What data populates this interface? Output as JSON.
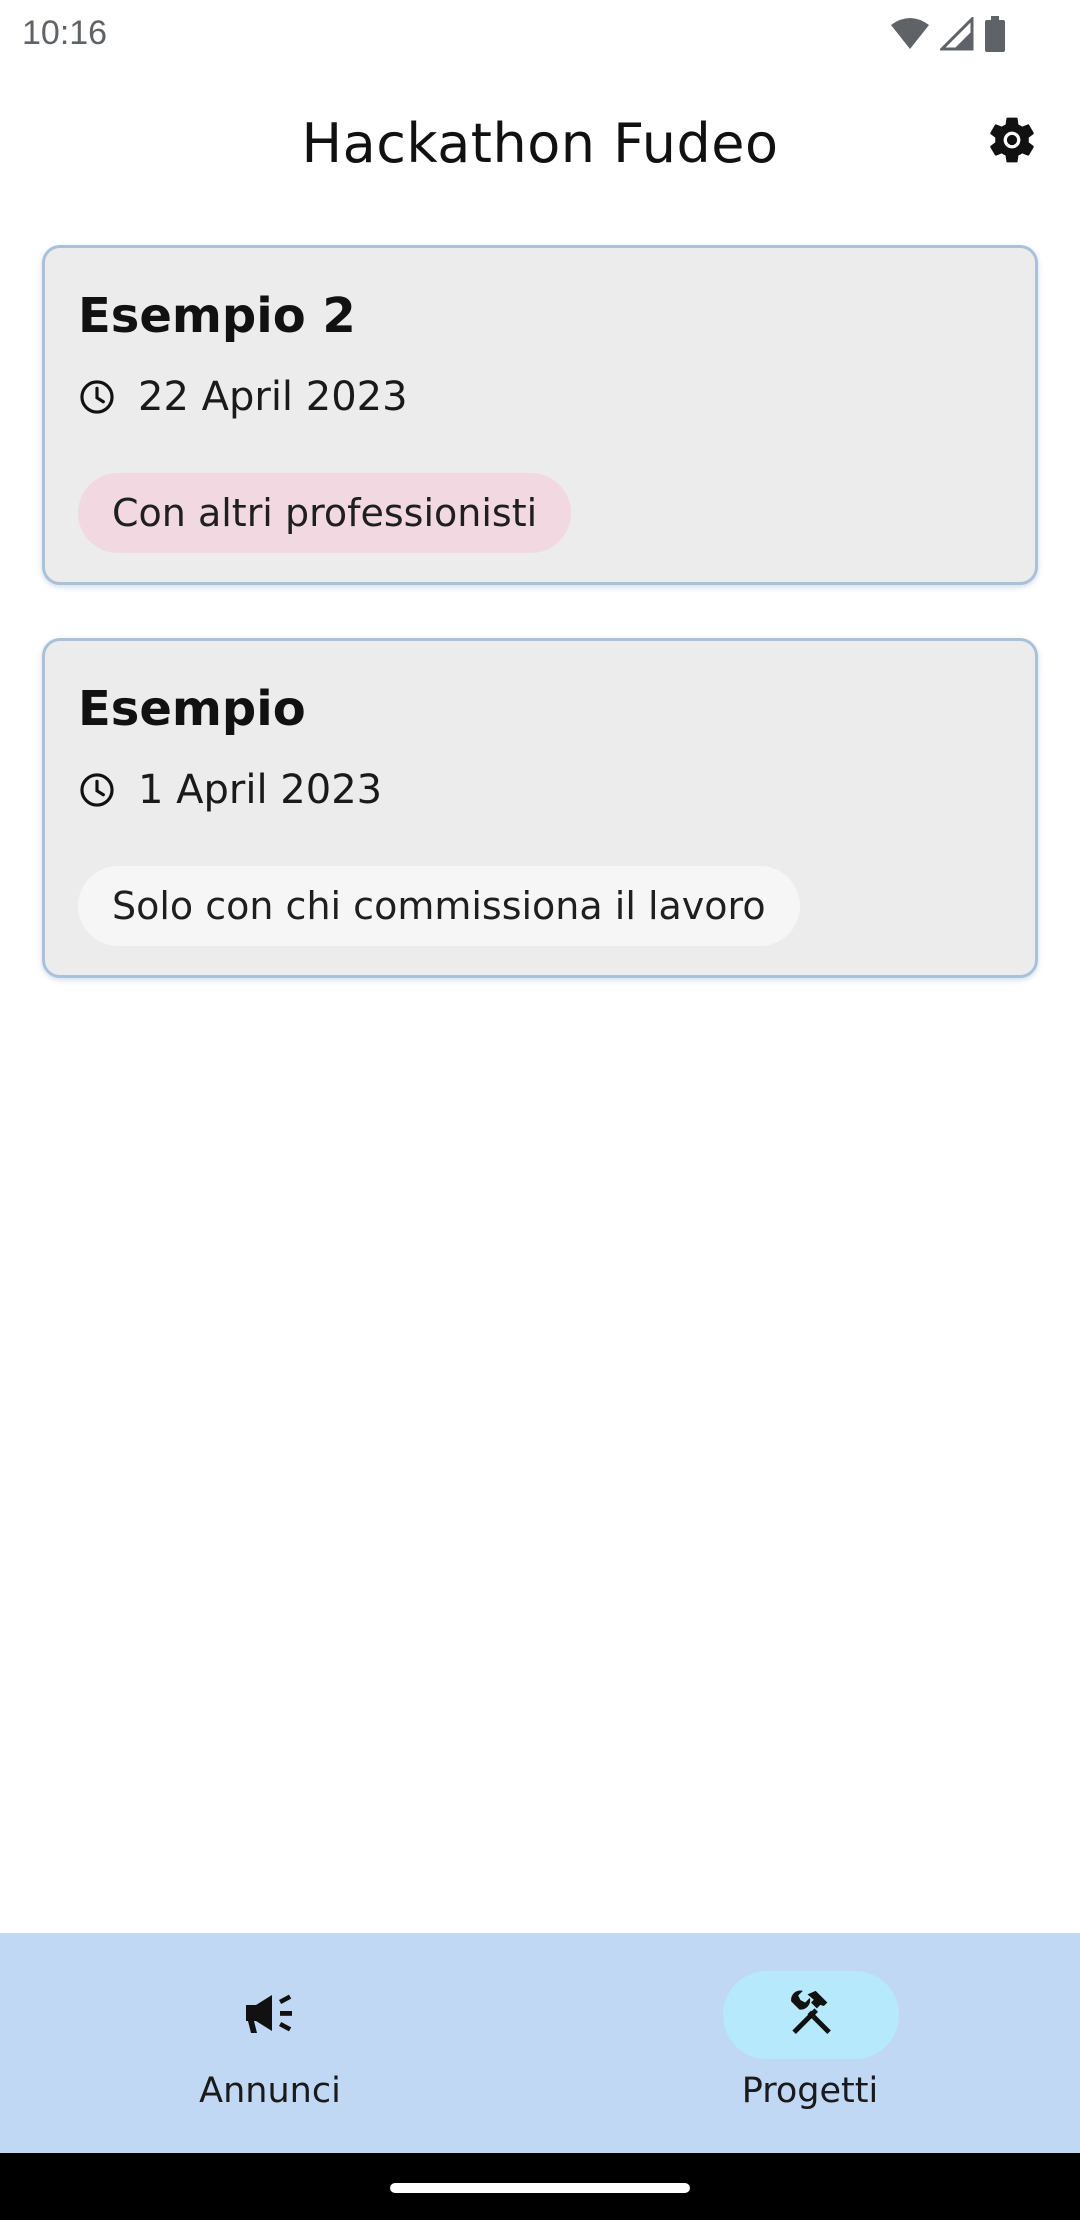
{
  "status_bar": {
    "time": "10:16",
    "icons": [
      "wifi-icon",
      "cell-signal-icon",
      "battery-icon"
    ]
  },
  "app_bar": {
    "title": "Hackathon Fudeo",
    "settings_icon": "gear-icon"
  },
  "projects": [
    {
      "title": "Esempio 2",
      "date": "22 April 2023",
      "tag": "Con altri professionisti",
      "tag_color": "#f2d9e1"
    },
    {
      "title": "Esempio",
      "date": "1 April 2023",
      "tag": "Solo con chi commissiona il lavoro",
      "tag_color": "#f6f6f6"
    }
  ],
  "bottom_nav": {
    "items": [
      {
        "label": "Annunci",
        "icon": "megaphone-icon",
        "selected": false
      },
      {
        "label": "Progetti",
        "icon": "hammer-wrench-icon",
        "selected": true
      }
    ]
  },
  "colors": {
    "card_background": "#ececec",
    "card_border": "#a8c2dc",
    "nav_background": "#c0d8f4",
    "nav_active_pill": "#b6e9fb"
  }
}
